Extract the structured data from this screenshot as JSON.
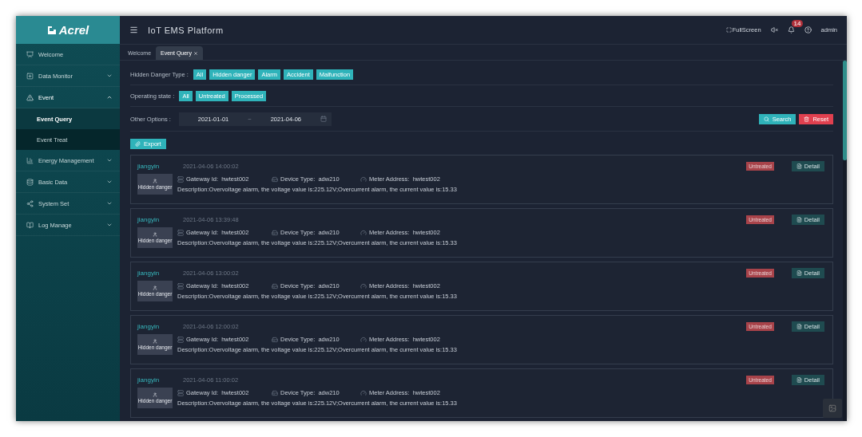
{
  "brand": {
    "logo": "Acrel"
  },
  "header": {
    "title": "IoT EMS Platform",
    "fullscreen": "FullScreen",
    "notification_count": "14",
    "user": "admin"
  },
  "sidebar": {
    "items": [
      {
        "label": "Welcome",
        "kind": "link"
      },
      {
        "label": "Data Monitor",
        "kind": "group",
        "expanded": false
      },
      {
        "label": "Event",
        "kind": "group",
        "expanded": true,
        "children": [
          {
            "label": "Event Query",
            "selected": true
          },
          {
            "label": "Event Treat",
            "selected": false
          }
        ]
      },
      {
        "label": "Energy Management",
        "kind": "group",
        "expanded": false
      },
      {
        "label": "Basic Data",
        "kind": "group",
        "expanded": false
      },
      {
        "label": "System Set",
        "kind": "group",
        "expanded": false
      },
      {
        "label": "Log Manage",
        "kind": "group",
        "expanded": false
      }
    ]
  },
  "tabs": [
    {
      "label": "Welcome",
      "selected": false
    },
    {
      "label": "Event Query",
      "selected": true
    }
  ],
  "filters": [
    {
      "label": "Hidden Danger Type :",
      "options": [
        "All",
        "Hidden danger",
        "Alarm",
        "Accident",
        "Malfunction"
      ]
    },
    {
      "label": "Operating state :",
      "options": [
        "All",
        "Untreated",
        "Processed"
      ]
    }
  ],
  "other_options": {
    "label": "Other Options :",
    "date_from": "2021-01-01",
    "separator": "~",
    "date_to": "2021-04-06"
  },
  "buttons": {
    "search": "Search",
    "reset": "Reset",
    "export": "Export"
  },
  "events": [
    {
      "site": "jiangyin",
      "time": "2021-04-06 14:00:02",
      "type": "Hidden danger",
      "gateway_label": "Gateway Id:",
      "gateway": "hwtest002",
      "device_label": "Device Type:",
      "device": "adw210",
      "meter_label": "Meter Address:",
      "meter": "hwtest002",
      "description": "Description:Overvoltage alarm, the voltage value is:225.12V;Overcurrent alarm, the current value is:15.33",
      "status": "Untreated",
      "action": "Detail"
    },
    {
      "site": "jiangyin",
      "time": "2021-04-06 13:39:48",
      "type": "Hidden danger",
      "gateway_label": "Gateway Id:",
      "gateway": "hwtest002",
      "device_label": "Device Type:",
      "device": "adw210",
      "meter_label": "Meter Address:",
      "meter": "hwtest002",
      "description": "Description:Overvoltage alarm, the voltage value is:225.12V;Overcurrent alarm, the current value is:15.33",
      "status": "Untreated",
      "action": "Detail"
    },
    {
      "site": "jiangyin",
      "time": "2021-04-06 13:00:02",
      "type": "Hidden danger",
      "gateway_label": "Gateway Id:",
      "gateway": "hwtest002",
      "device_label": "Device Type:",
      "device": "adw210",
      "meter_label": "Meter Address:",
      "meter": "hwtest002",
      "description": "Description:Overvoltage alarm, the voltage value is:225.12V;Overcurrent alarm, the current value is:15.33",
      "status": "Untreated",
      "action": "Detail"
    },
    {
      "site": "jiangyin",
      "time": "2021-04-06 12:00:02",
      "type": "Hidden danger",
      "gateway_label": "Gateway Id:",
      "gateway": "hwtest002",
      "device_label": "Device Type:",
      "device": "adw210",
      "meter_label": "Meter Address:",
      "meter": "hwtest002",
      "description": "Description:Overvoltage alarm, the voltage value is:225.12V;Overcurrent alarm, the current value is:15.33",
      "status": "Untreated",
      "action": "Detail"
    },
    {
      "site": "jiangyin",
      "time": "2021-04-06 11:00:02",
      "type": "Hidden danger",
      "gateway_label": "Gateway Id:",
      "gateway": "hwtest002",
      "device_label": "Device Type:",
      "device": "adw210",
      "meter_label": "Meter Address:",
      "meter": "hwtest002",
      "description": "Description:Overvoltage alarm, the voltage value is:225.12V;Overcurrent alarm, the current value is:15.33",
      "status": "Untreated",
      "action": "Detail"
    }
  ]
}
